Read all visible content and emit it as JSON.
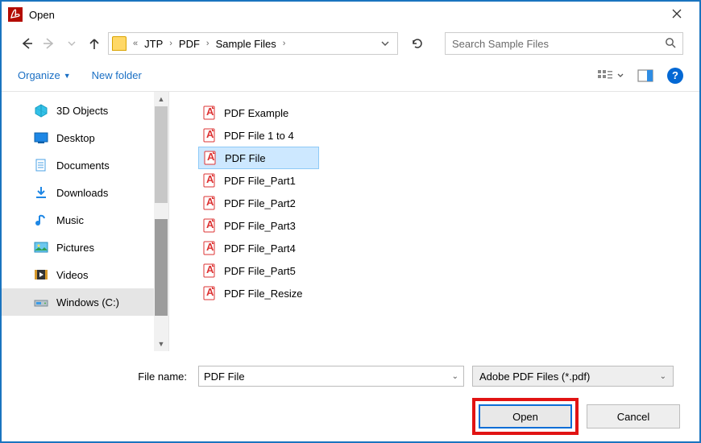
{
  "window": {
    "title": "Open"
  },
  "breadcrumb": {
    "prefix": "«",
    "items": [
      "JTP",
      "PDF",
      "Sample Files"
    ]
  },
  "search": {
    "placeholder": "Search Sample Files"
  },
  "toolbar": {
    "organize": "Organize",
    "new_folder": "New folder"
  },
  "sidebar": {
    "items": [
      {
        "label": "3D Objects",
        "icon": "3d"
      },
      {
        "label": "Desktop",
        "icon": "desktop"
      },
      {
        "label": "Documents",
        "icon": "documents"
      },
      {
        "label": "Downloads",
        "icon": "downloads"
      },
      {
        "label": "Music",
        "icon": "music"
      },
      {
        "label": "Pictures",
        "icon": "pictures"
      },
      {
        "label": "Videos",
        "icon": "videos"
      },
      {
        "label": "Windows (C:)",
        "icon": "drive",
        "selected": true
      }
    ]
  },
  "files": {
    "items": [
      {
        "name": "PDF Example"
      },
      {
        "name": "PDF File 1 to 4"
      },
      {
        "name": "PDF File",
        "selected": true
      },
      {
        "name": "PDF File_Part1"
      },
      {
        "name": "PDF File_Part2"
      },
      {
        "name": "PDF File_Part3"
      },
      {
        "name": "PDF File_Part4"
      },
      {
        "name": "PDF File_Part5"
      },
      {
        "name": "PDF File_Resize"
      }
    ]
  },
  "footer": {
    "filename_label": "File name:",
    "filename_value": "PDF File",
    "filetype": "Adobe PDF Files (*.pdf)",
    "open": "Open",
    "cancel": "Cancel"
  }
}
